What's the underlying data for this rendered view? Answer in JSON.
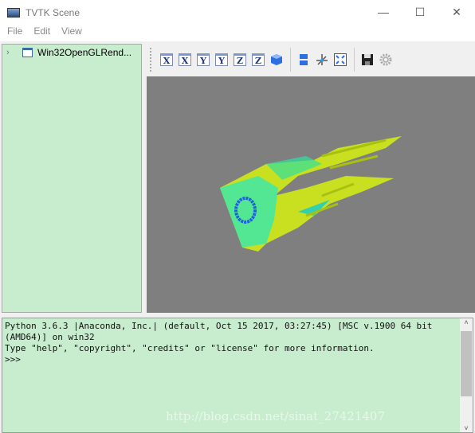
{
  "window": {
    "title": "TVTK Scene"
  },
  "menu": [
    "File",
    "Edit",
    "View"
  ],
  "tree": {
    "items": [
      {
        "label": "Win32OpenGLRend..."
      }
    ]
  },
  "toolbar": {
    "buttons": [
      {
        "icon": "view-x-plus-icon",
        "glyph": "X"
      },
      {
        "icon": "view-x-minus-icon",
        "glyph": "X"
      },
      {
        "icon": "view-y-plus-icon",
        "glyph": "Y"
      },
      {
        "icon": "view-y-minus-icon",
        "glyph": "Y"
      },
      {
        "icon": "view-z-plus-icon",
        "glyph": "Z"
      },
      {
        "icon": "view-z-minus-icon",
        "glyph": "Z"
      }
    ]
  },
  "console": {
    "lines": [
      "Python 3.6.3 |Anaconda, Inc.| (default, Oct 15 2017, 03:27:45) [MSC v.1900 64 bit",
      "(AMD64)] on win32",
      "Type \"help\", \"copyright\", \"credits\" or \"license\" for more information.",
      ">>>"
    ]
  },
  "watermark": "http://blog.csdn.net/sinat_27421407",
  "colors": {
    "panel": "#c8ecce",
    "viewport": "#7f7f7f",
    "surface": "#c8e020",
    "surface2": "#30e0a0",
    "ring": "#2060e0"
  }
}
